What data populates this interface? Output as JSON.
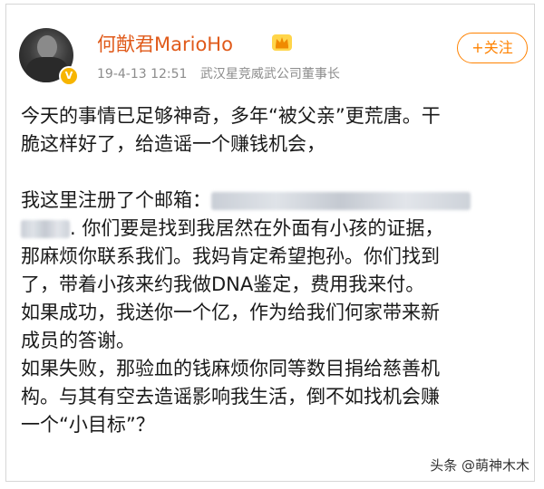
{
  "user": {
    "name": "何猷君MarioHo",
    "verified_badge": "V",
    "crown_icon": "crown-icon"
  },
  "meta": {
    "time": "19-4-13 12:51",
    "title": "武汉星竞威武公司董事长"
  },
  "follow_label": "+关注",
  "post": {
    "line1": "今天的事情已足够神奇，多年“被父亲”更荒唐。干",
    "line2": "脆这样好了，给造谣一个赚钱机会，",
    "line3": "我这里注册了个邮箱：",
    "line4_tail": ". 你们要是找到我居然在外面有小孩的证据，",
    "line5": "那麻烦你联系我们。我妈肯定希望抱孙。你们找到",
    "line6": "了，带着小孩来约我做DNA鉴定，费用我来付。",
    "line7": "如果成功，我送你一个亿，作为给我们何家带来新",
    "line8": "成员的答谢。",
    "line9": "如果失败，那验血的钱麻烦你同等数目捐给慈善机",
    "line10": "构。与其有空去造谣影响我生活，倒不如找机会赚",
    "line11": "一个“小目标”？"
  },
  "watermark": "头条 @萌神木木"
}
